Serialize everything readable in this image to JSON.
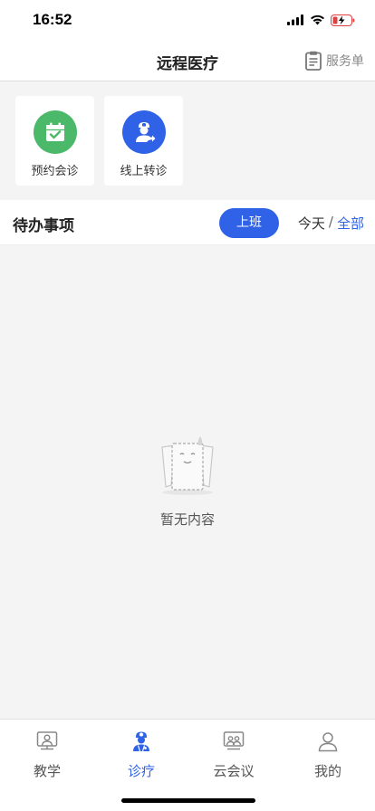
{
  "status_bar": {
    "time": "16:52"
  },
  "nav": {
    "title": "远程医疗",
    "service_label": "服务单"
  },
  "quick_actions": [
    {
      "label": "预约会诊",
      "icon": "calendar-check-icon",
      "color": "#4cb96a"
    },
    {
      "label": "线上转诊",
      "icon": "doctor-transfer-icon",
      "color": "#2f62e6"
    }
  ],
  "todo": {
    "title": "待办事项",
    "shift_button": "上班",
    "filter_today": "今天",
    "filter_separator": "/",
    "filter_all": "全部"
  },
  "empty": {
    "text": "暂无内容"
  },
  "tabs": [
    {
      "label": "教学",
      "icon": "teaching-icon",
      "active": false
    },
    {
      "label": "诊疗",
      "icon": "doctor-icon",
      "active": true
    },
    {
      "label": "云会议",
      "icon": "meeting-icon",
      "active": false
    },
    {
      "label": "我的",
      "icon": "profile-icon",
      "active": false
    }
  ],
  "colors": {
    "accent": "#2f62e6",
    "green": "#4cb96a"
  }
}
